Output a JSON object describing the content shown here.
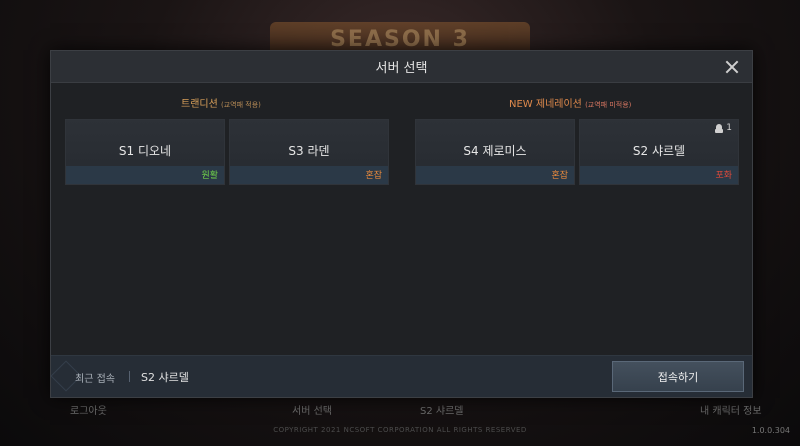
{
  "background": {
    "season_banner": "SEASON 3",
    "footer_items": [
      "로그아웃",
      "서버 선택",
      "S2 샤르델",
      "내 캐릭터 정보"
    ],
    "copyright": "COPYRIGHT 2021 NCSOFT CORPORATION ALL RIGHTS RESERVED",
    "version": "1.0.0.304"
  },
  "modal": {
    "title": "서버 선택",
    "groups": [
      {
        "title": "트랜디션",
        "subtitle": "(교역패 적용)",
        "servers": [
          {
            "name": "S1 디오네",
            "status": "원활",
            "status_color": "#6fd14a"
          },
          {
            "name": "S3 라덴",
            "status": "혼잡",
            "status_color": "#e88a3c"
          }
        ]
      },
      {
        "title": "NEW 제네레이션",
        "subtitle": "(교역패 미적용)",
        "servers": [
          {
            "name": "S4 제로미스",
            "status": "혼잡",
            "status_color": "#e88a3c"
          },
          {
            "name": "S2 샤르델",
            "status": "포화",
            "status_color": "#e04a3a",
            "character_count": "1"
          }
        ]
      }
    ],
    "footer": {
      "recent_label": "최근 접속",
      "recent_server": "S2 샤르델",
      "connect_label": "접속하기"
    }
  }
}
